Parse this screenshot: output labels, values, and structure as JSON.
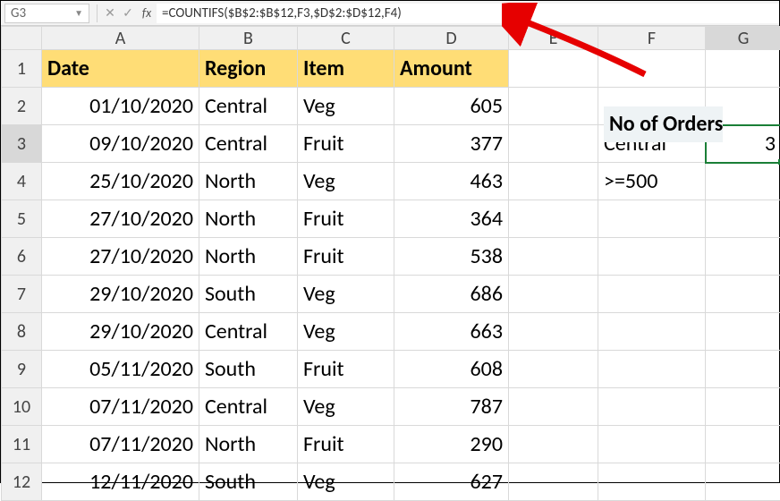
{
  "nameBox": "G3",
  "formula": "=COUNTIFS($B$2:$B$12,F3,$D$2:$D$12,F4)",
  "columns": [
    "A",
    "B",
    "C",
    "D",
    "E",
    "F",
    "G"
  ],
  "headers": {
    "A": "Date",
    "B": "Region",
    "C": "Item",
    "D": "Amount"
  },
  "rows": [
    {
      "date": "01/10/2020",
      "region": "Central",
      "item": "Veg",
      "amount": "605"
    },
    {
      "date": "09/10/2020",
      "region": "Central",
      "item": "Fruit",
      "amount": "377"
    },
    {
      "date": "25/10/2020",
      "region": "North",
      "item": "Veg",
      "amount": "463"
    },
    {
      "date": "27/10/2020",
      "region": "North",
      "item": "Fruit",
      "amount": "364"
    },
    {
      "date": "27/10/2020",
      "region": "North",
      "item": "Fruit",
      "amount": "538"
    },
    {
      "date": "29/10/2020",
      "region": "South",
      "item": "Veg",
      "amount": "686"
    },
    {
      "date": "29/10/2020",
      "region": "Central",
      "item": "Veg",
      "amount": "663"
    },
    {
      "date": "05/11/2020",
      "region": "South",
      "item": "Fruit",
      "amount": "608"
    },
    {
      "date": "07/11/2020",
      "region": "Central",
      "item": "Veg",
      "amount": "787"
    },
    {
      "date": "07/11/2020",
      "region": "North",
      "item": "Fruit",
      "amount": "290"
    },
    {
      "date": "12/11/2020",
      "region": "South",
      "item": "Veg",
      "amount": "627"
    }
  ],
  "side": {
    "title": "No of Orders",
    "f3": "Central",
    "g3": "3",
    "f4": ">=500"
  },
  "selectedCell": "G3"
}
